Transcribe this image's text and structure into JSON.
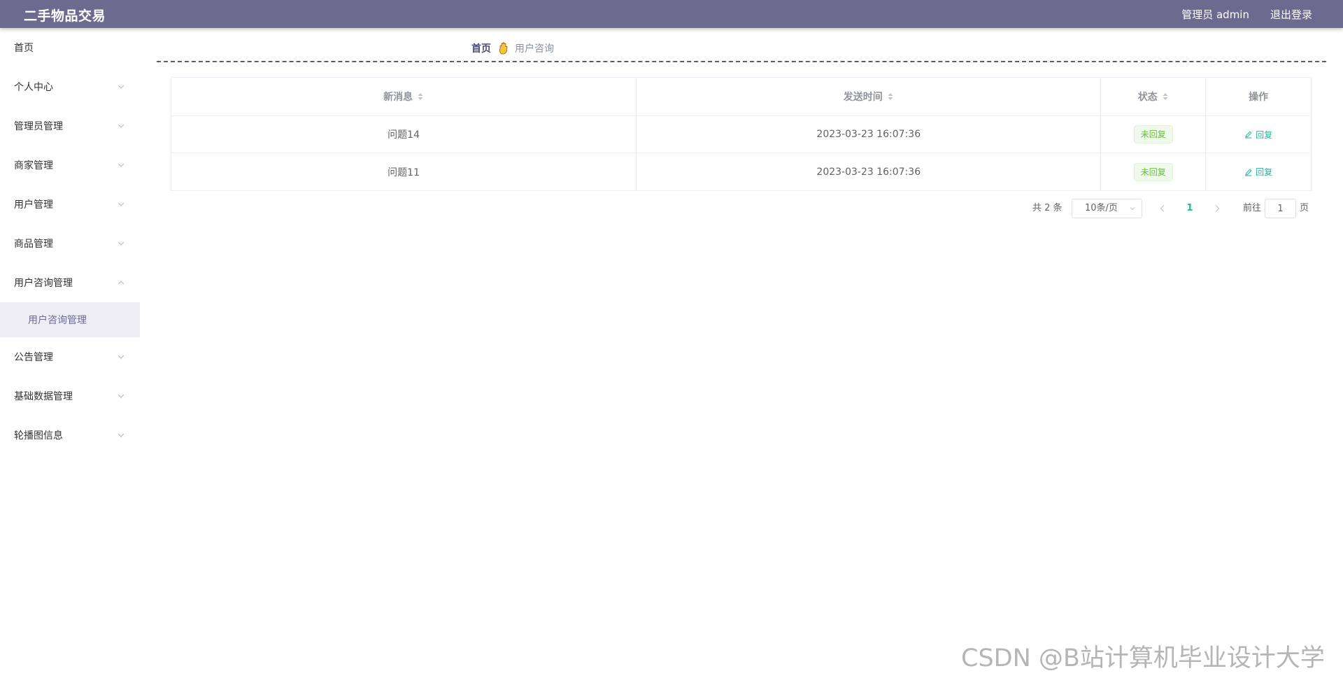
{
  "header": {
    "title": "二手物品交易",
    "user_info": "管理员 admin",
    "logout_label": "退出登录"
  },
  "sidebar": {
    "items": [
      {
        "label": "首页",
        "has_chevron": false
      },
      {
        "label": "个人中心",
        "has_chevron": true
      },
      {
        "label": "管理员管理",
        "has_chevron": true
      },
      {
        "label": "商家管理",
        "has_chevron": true
      },
      {
        "label": "用户管理",
        "has_chevron": true
      },
      {
        "label": "商品管理",
        "has_chevron": true
      },
      {
        "label": "用户咨询管理",
        "has_chevron": true,
        "expanded": true
      },
      {
        "label": "公告管理",
        "has_chevron": true
      },
      {
        "label": "基础数据管理",
        "has_chevron": true
      },
      {
        "label": "轮播图信息",
        "has_chevron": true
      }
    ],
    "active_submenu": {
      "label": "用户咨询管理"
    }
  },
  "breadcrumb": {
    "home": "首页",
    "current": "用户咨询"
  },
  "table": {
    "columns": [
      {
        "label": "新消息",
        "sortable": true
      },
      {
        "label": "发送时间",
        "sortable": true
      },
      {
        "label": "状态",
        "sortable": true
      },
      {
        "label": "操作",
        "sortable": false
      }
    ],
    "rows": [
      {
        "message": "问题14",
        "time": "2023-03-23 16:07:36",
        "status": "未回复",
        "action": "回复"
      },
      {
        "message": "问题11",
        "time": "2023-03-23 16:07:36",
        "status": "未回复",
        "action": "回复"
      }
    ]
  },
  "pagination": {
    "total_text": "共 2 条",
    "page_size": "10条/页",
    "current_page": "1",
    "goto_label": "前往",
    "goto_value": "1",
    "page_suffix": "页"
  },
  "watermark": "CSDN @B站计算机毕业设计大学",
  "colors": {
    "header_bg": "#6c6b8f",
    "accent": "#26b59a",
    "status_tag": "#67c23a",
    "submenu_active_bg": "#efeef7"
  }
}
